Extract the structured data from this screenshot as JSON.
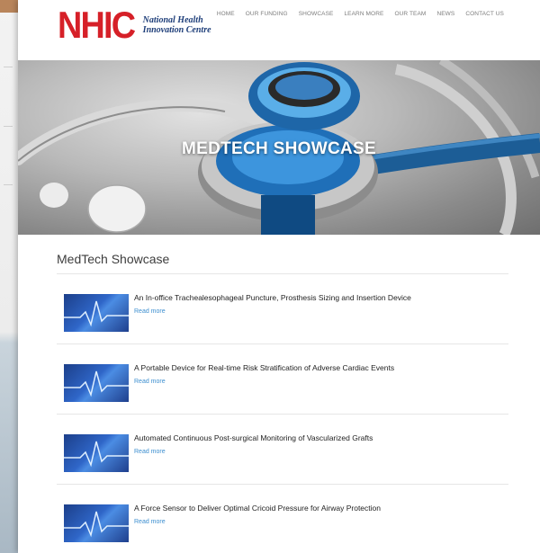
{
  "logo": {
    "mark": "NHIC",
    "line1": "National Health",
    "line2": "Innovation Centre"
  },
  "nav": [
    "HOME",
    "OUR FUNDING",
    "SHOWCASE",
    "LEARN MORE",
    "OUR TEAM",
    "NEWS",
    "CONTACT US"
  ],
  "hero": {
    "title": "MEDTECH SHOWCASE"
  },
  "section": {
    "title": "MedTech Showcase"
  },
  "items": [
    {
      "title": "An In-office Trachealesophageal Puncture, Prosthesis Sizing and Insertion Device",
      "link": "Read more"
    },
    {
      "title": "A Portable Device for Real-time Risk Stratification of Adverse Cardiac Events",
      "link": "Read more"
    },
    {
      "title": "Automated Continuous Post-surgical Monitoring of Vascularized Grafts",
      "link": "Read more"
    },
    {
      "title": "A Force Sensor to Deliver Optimal Cricoid Pressure for Airway Protection",
      "link": "Read more"
    }
  ],
  "colors": {
    "brand_red": "#d62028",
    "brand_blue": "#1f3f7a",
    "link_blue": "#3d8fd0"
  }
}
